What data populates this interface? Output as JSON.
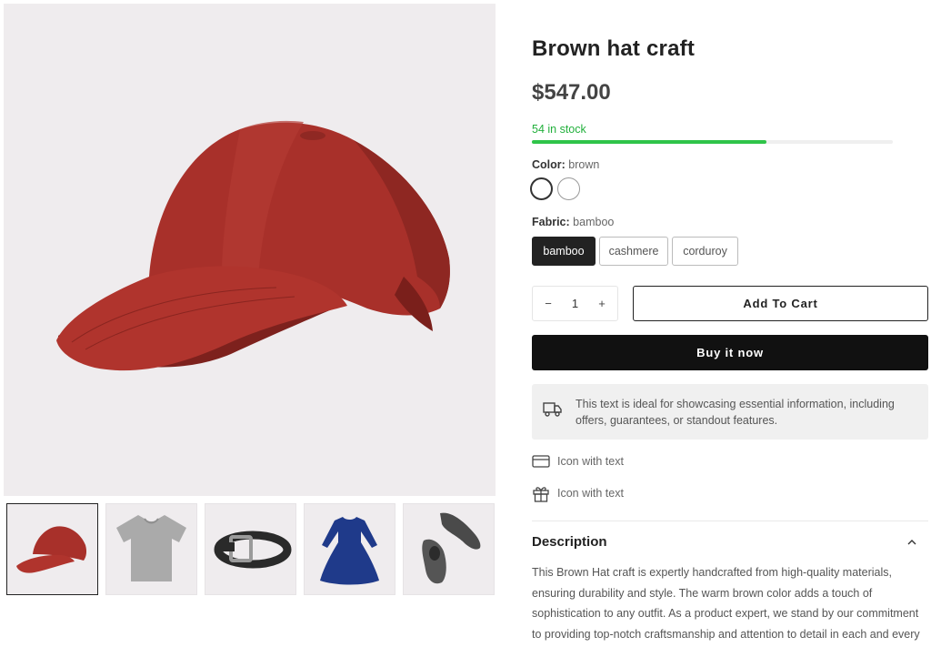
{
  "product": {
    "title": "Brown hat craft",
    "price": "$547.00",
    "stock_text": "54 in stock",
    "stock_level_percent": 65
  },
  "options": {
    "color": {
      "label": "Color:",
      "selected": "brown",
      "swatches": [
        "brown",
        "white"
      ]
    },
    "fabric": {
      "label": "Fabric:",
      "selected": "bamboo",
      "choices": [
        "bamboo",
        "cashmere",
        "corduroy"
      ]
    }
  },
  "purchase": {
    "quantity": "1",
    "minus_symbol": "−",
    "plus_symbol": "+",
    "add_to_cart_label": "Add To Cart",
    "buy_now_label": "Buy it now"
  },
  "notice": {
    "icon": "truck-icon",
    "text": "This text is ideal for showcasing essential information, including offers, guarantees, or standout features."
  },
  "features": [
    {
      "icon": "credit-card-icon",
      "text": "Icon with text"
    },
    {
      "icon": "gift-icon",
      "text": "Icon with text"
    }
  ],
  "description": {
    "title": "Description",
    "text": "This Brown Hat craft is expertly handcrafted from high-quality materials, ensuring durability and style. The warm brown color adds a touch of sophistication to any outfit. As a product expert, we stand by our commitment to providing top-notch craftsmanship and attention to detail in each and every hat."
  },
  "gallery": {
    "main": "red-cap",
    "thumbnails": [
      "red-cap",
      "grey-tshirt",
      "black-belt",
      "blue-dress",
      "grey-shoes"
    ]
  },
  "colors": {
    "stock_green": "#2fc449",
    "cap_red": "#a8302a",
    "gallery_bg": "#efecee",
    "button_dark": "#111111"
  }
}
